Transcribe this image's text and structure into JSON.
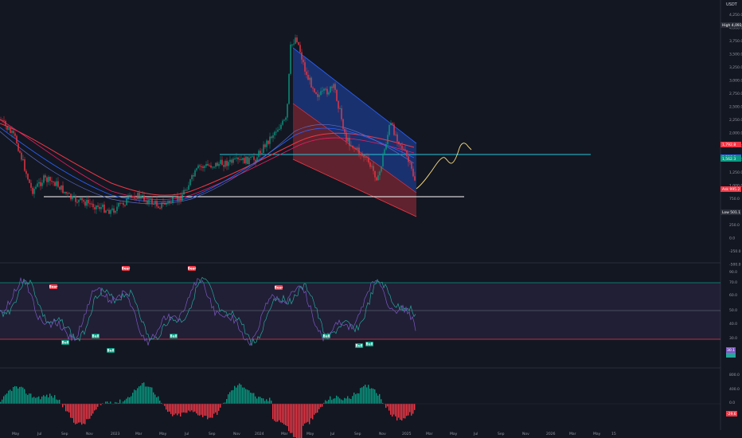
{
  "header": {
    "currency": "USDT"
  },
  "price_axis": {
    "ticks": [
      "4,250.0",
      "4,000.0",
      "3,750.0",
      "3,500.0",
      "3,250.0",
      "3,000.0",
      "2,750.0",
      "2,500.0",
      "2,250.0",
      "2,000.0",
      "1,750.0",
      "1,500.0",
      "1,250.0",
      "1,000.0",
      "750.0",
      "500.0",
      "250.0",
      "0.0",
      "-250.0",
      "-500.0"
    ],
    "tags": [
      {
        "label": "High",
        "value": "4,093.3",
        "color": "#2a2e39"
      },
      {
        "label": "",
        "value": "1,792.8",
        "color": "#f23645"
      },
      {
        "label": "",
        "value": "1,596.6",
        "color": "#2962ff"
      },
      {
        "label": "",
        "value": "1,562.3",
        "color": "#089981"
      },
      {
        "label": "Ask",
        "value": "995.2",
        "color": "#f23645"
      },
      {
        "label": "Low",
        "value": "501.1",
        "color": "#2a2e39"
      }
    ]
  },
  "rsi_axis": {
    "ticks": [
      "90.0",
      "70.0",
      "60.0",
      "50.0",
      "40.0",
      "30.0"
    ],
    "tag": "30.1"
  },
  "macd_axis": {
    "ticks": [
      "800.0",
      "400.0",
      "0.0"
    ],
    "tag": "-29.6"
  },
  "time_axis": {
    "labels": [
      "May",
      "Jul",
      "Sep",
      "Nov",
      "2023",
      "Mar",
      "May",
      "Jul",
      "Sep",
      "Nov",
      "2024",
      "Mar",
      "May",
      "Jul",
      "Sep",
      "Nov",
      "2025",
      "Mar",
      "May",
      "Jul",
      "Sep",
      "Nov",
      "2026",
      "Mar",
      "May",
      "15"
    ]
  },
  "signals": {
    "bear": [
      "Bear",
      "Bear",
      "Bear",
      "Bear"
    ],
    "bull": [
      "Bull",
      "Bull",
      "Bull",
      "Bull",
      "Bull",
      "Bull",
      "Bull"
    ]
  },
  "colors": {
    "up": "#089981",
    "down": "#f23645",
    "horizontal_line": "#26c6da",
    "support_line": "#ffffff",
    "projection": "#ffe082"
  },
  "chart_data": {
    "type": "line",
    "symbol_currency": "USDT",
    "price_ylim": [
      -500,
      4250
    ],
    "series": [
      {
        "name": "",
        "x": [
          "May",
          "Jul",
          "Sep",
          "Nov",
          "2023",
          "Mar",
          "May",
          "Jul",
          "Sep",
          "Nov",
          "2024",
          "Mar",
          "May",
          "Jul",
          "Sep",
          "Nov",
          "2025"
        ],
        "values": [
          1900,
          1100,
          1500,
          1250,
          1200,
          1550,
          1800,
          1850,
          1650,
          1900,
          2300,
          3950,
          3000,
          3400,
          2400,
          3300,
          1600
        ]
      }
    ],
    "levels": {
      "resistance": 1562.3,
      "support": 1000
    }
  }
}
